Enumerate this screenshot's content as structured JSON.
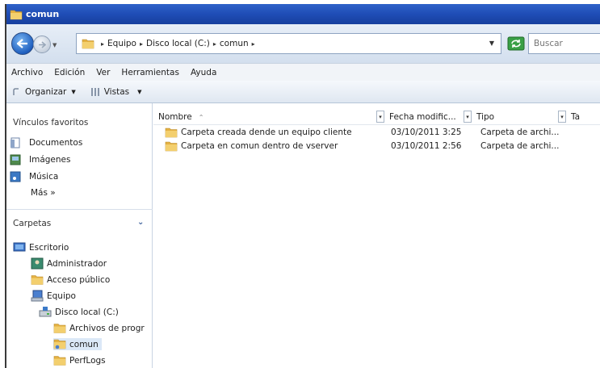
{
  "window": {
    "title": "comun"
  },
  "address": {
    "crumbs": [
      "Equipo",
      "Disco local (C:)",
      "comun"
    ],
    "search_placeholder": "Buscar"
  },
  "menu": [
    "Archivo",
    "Edición",
    "Ver",
    "Herramientas",
    "Ayuda"
  ],
  "toolbar": {
    "organize": "Organizar",
    "views": "Vistas"
  },
  "nav": {
    "favorites_title": "Vínculos favoritos",
    "favorites": [
      {
        "label": "Documentos",
        "icon": "documents-icon"
      },
      {
        "label": "Imágenes",
        "icon": "pictures-icon"
      },
      {
        "label": "Música",
        "icon": "music-icon"
      }
    ],
    "more": "Más »",
    "folders_title": "Carpetas",
    "tree": [
      {
        "label": "Escritorio",
        "icon": "desktop-icon",
        "indent": 0
      },
      {
        "label": "Administrador",
        "icon": "user-folder-icon",
        "indent": 1
      },
      {
        "label": "Acceso público",
        "icon": "folder-icon",
        "indent": 1
      },
      {
        "label": "Equipo",
        "icon": "computer-icon",
        "indent": 1
      },
      {
        "label": "Disco local (C:)",
        "icon": "drive-icon",
        "indent": 2
      },
      {
        "label": "Archivos de progr",
        "icon": "folder-icon",
        "indent": 3
      },
      {
        "label": "comun",
        "icon": "shared-folder-icon",
        "indent": 3,
        "selected": true
      },
      {
        "label": "PerfLogs",
        "icon": "folder-icon",
        "indent": 3
      }
    ]
  },
  "list": {
    "columns": [
      "Nombre",
      "Fecha modific...",
      "Tipo",
      "Ta"
    ],
    "rows": [
      {
        "name": "Carpeta creada dende un equipo cliente",
        "date": "03/10/2011 3:25",
        "type": "Carpeta de archi..."
      },
      {
        "name": "Carpeta en comun dentro de vserver",
        "date": "03/10/2011 2:56",
        "type": "Carpeta de archi..."
      }
    ]
  },
  "colors": {
    "titlebar": "#1f4db6",
    "folder": "#e8b84a",
    "selection": "#dbe8f7"
  }
}
